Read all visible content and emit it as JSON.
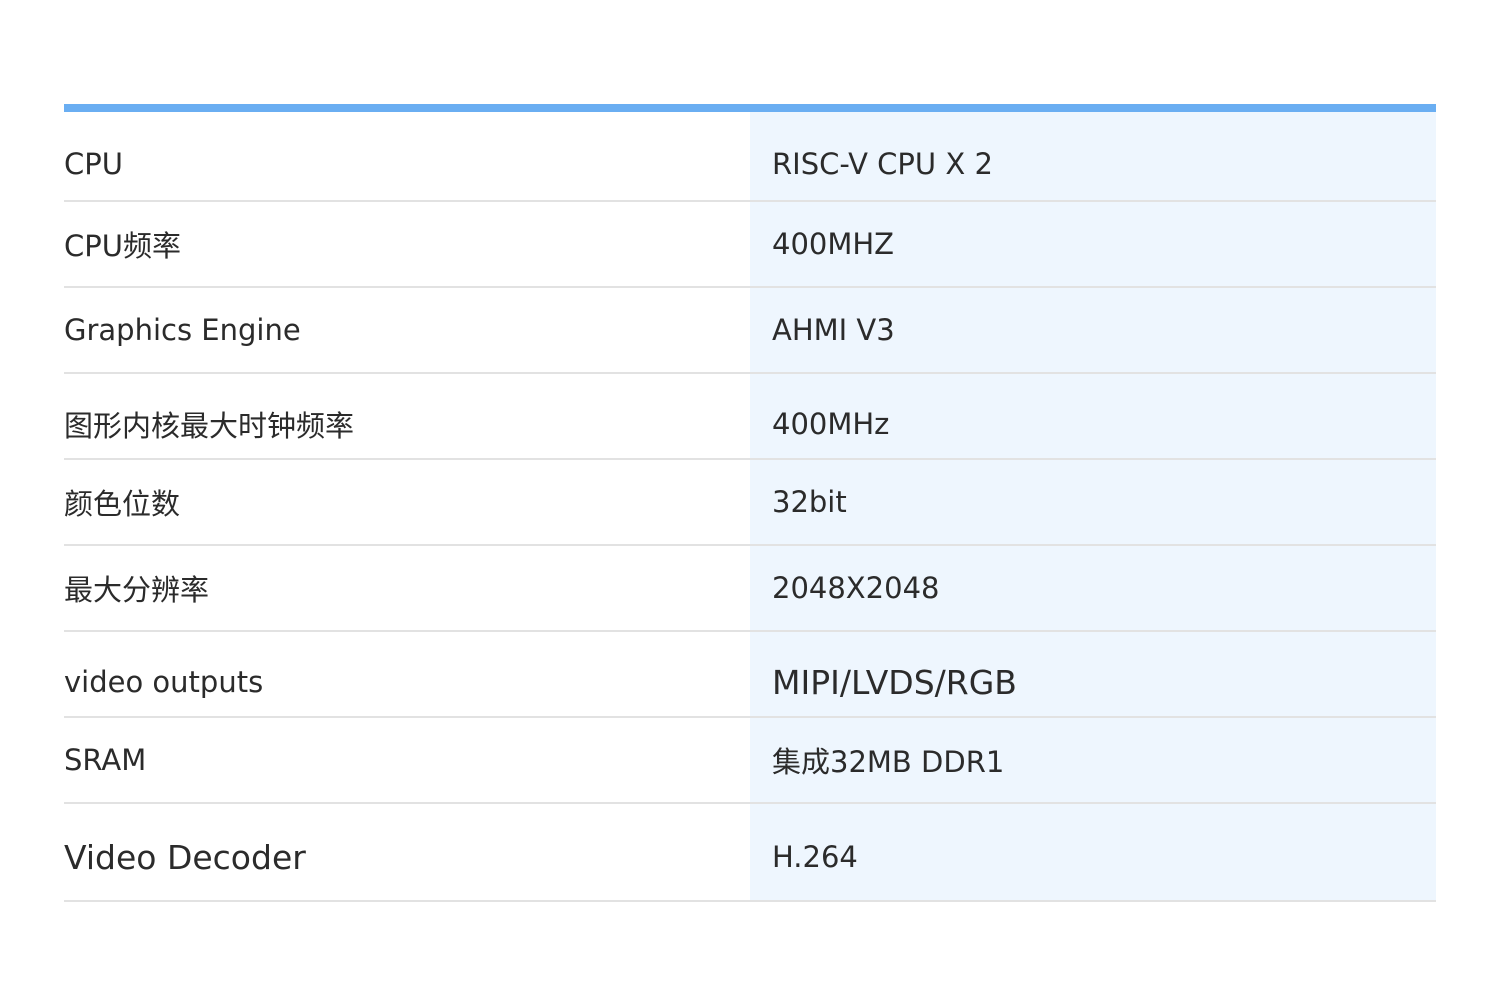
{
  "table": {
    "rows": [
      {
        "label": "CPU",
        "value": "RISC-V CPU X 2"
      },
      {
        "label": "CPU频率",
        "value": "400MHZ"
      },
      {
        "label": "Graphics Engine",
        "value": "AHMI V3"
      },
      {
        "label": "图形内核最大时钟频率",
        "value": "400MHz"
      },
      {
        "label": "颜色位数",
        "value": "32bit"
      },
      {
        "label": "最大分辨率",
        "value": "2048X2048"
      },
      {
        "label": "video outputs",
        "value": "MIPI/LVDS/RGB"
      },
      {
        "label": "SRAM",
        "value": "集成32MB DDR1"
      },
      {
        "label": "Video Decoder",
        "value": "H.264"
      }
    ]
  },
  "colors": {
    "accent_bar": "#6aaef2",
    "value_column_bg": "#eef6fe",
    "divider": "#e2e2e2",
    "text": "#2b2b2b"
  }
}
